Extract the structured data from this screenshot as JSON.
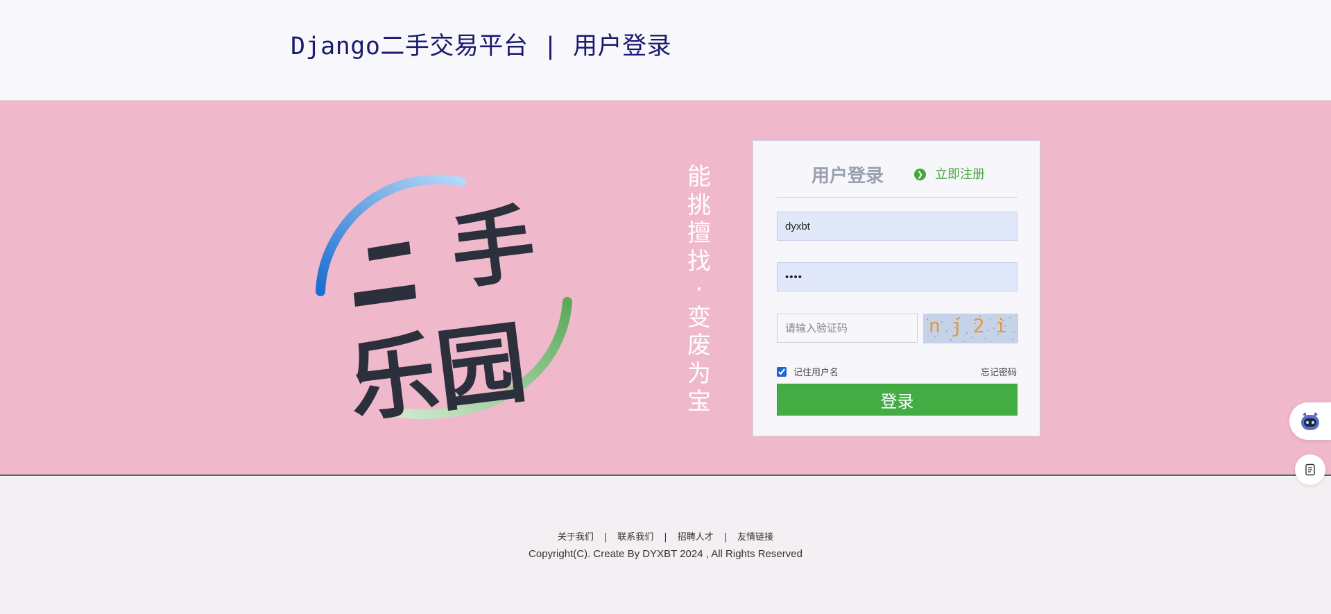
{
  "header": {
    "title": "Django二手交易平台 | 用户登录"
  },
  "banner": {
    "logo": {
      "line1": "二手",
      "line2": "乐园"
    },
    "slogan": [
      "能",
      "挑",
      "擅",
      "找",
      "·",
      "变",
      "废",
      "为",
      "宝"
    ]
  },
  "login": {
    "title": "用户登录",
    "register_label": "立即注册",
    "username_value": "dyxbt",
    "password_value": "••••",
    "captcha_placeholder": "请输入验证码",
    "captcha_text": "nj2i",
    "remember_label": "记住用户名",
    "remember_checked": true,
    "forgot_label": "忘记密码",
    "submit_label": "登录"
  },
  "footer": {
    "links": [
      "关于我们",
      "联系我们",
      "招聘人才",
      "友情链接"
    ],
    "copyright": "Copyright(C). Create By DYXBT 2024 , All Rights Reserved"
  },
  "colors": {
    "banner_bg": "#f0b8cb",
    "accent_green": "#43ad44",
    "title_navy": "#1a1a6e"
  },
  "widgets": {
    "robot": "robot-assistant-icon",
    "notes": "notes-icon"
  }
}
